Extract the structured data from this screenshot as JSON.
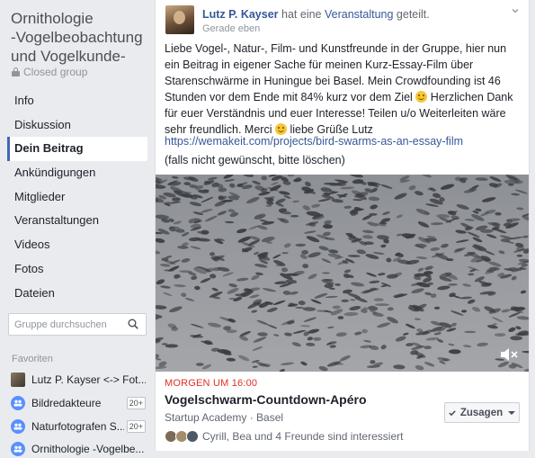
{
  "sidebar": {
    "group_title_lines": [
      "Ornithologie",
      "-Vogelbeobachtung",
      "und Vogelkunde-"
    ],
    "privacy": "Closed group",
    "nav": [
      {
        "label": "Info",
        "active": false
      },
      {
        "label": "Diskussion",
        "active": false
      },
      {
        "label": "Dein Beitrag",
        "active": true
      },
      {
        "label": "Ankündigungen",
        "active": false
      },
      {
        "label": "Mitglieder",
        "active": false
      },
      {
        "label": "Veranstaltungen",
        "active": false
      },
      {
        "label": "Videos",
        "active": false
      },
      {
        "label": "Fotos",
        "active": false
      },
      {
        "label": "Dateien",
        "active": false
      }
    ],
    "search_placeholder": "Gruppe durchsuchen",
    "favorites_title": "Favoriten",
    "favorites": [
      {
        "label": "Lutz P. Kayser <-> Fot...",
        "badge": ""
      },
      {
        "label": "Bildredakteure",
        "badge": "20+"
      },
      {
        "label": "Naturfotografen S...",
        "badge": "20+"
      },
      {
        "label": "Ornithologie -Vogelbe...",
        "badge": ""
      }
    ]
  },
  "post": {
    "author": "Lutz P. Kayser",
    "action_pre": "hat eine",
    "action_link": "Veranstaltung",
    "action_post": "geteilt.",
    "timestamp": "Gerade eben",
    "text_part1": "Liebe Vogel-, Natur-, Film- und Kunstfreunde in der Gruppe, hier nun ein Beitrag in eigener Sache für meinen Kurz-Essay-Film über Starenschwärme in Huningue bei Basel. Mein Crowdfounding ist 46 Stunden vor dem Ende mit 84% kurz vor dem Ziel",
    "text_part2": "Herzlichen Dank für euer Verständnis und euer Interesse! Teilen u/o Weiterleiten wäre sehr freundlich. Merci",
    "text_part3": "liebe Grüße Lutz",
    "link": "https://wemakeit.com/projects/bird-swarms-as-an-essay-film",
    "note": "(falls nicht gewünscht, bitte löschen)"
  },
  "event": {
    "date": "MORGEN UM 16:00",
    "title": "Vogelschwarm-Countdown-Apéro",
    "venue": "Startup Academy · Basel",
    "going_label": "Zusagen",
    "interested": "Cyrill, Bea und 4 Freunde sind interessiert"
  },
  "colors": {
    "accent": "#4267b2",
    "link": "#365899",
    "date_red": "#e02f24",
    "background": "#e9ebee"
  },
  "icons": [
    "lock-icon",
    "search-icon",
    "chevron-down-icon",
    "mute-icon",
    "check-icon",
    "smile-emoji-icon",
    "group-icon"
  ]
}
